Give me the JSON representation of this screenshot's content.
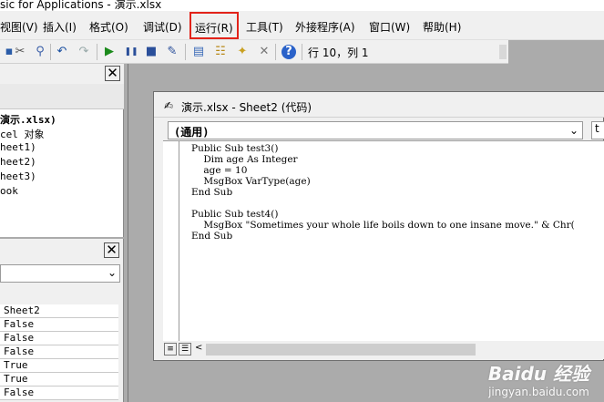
{
  "window": {
    "title": "sic for Applications - 演示.xlsx"
  },
  "menu": {
    "items": [
      {
        "label": "视图(V)"
      },
      {
        "label": "插入(I)"
      },
      {
        "label": "格式(O)"
      },
      {
        "label": "调试(D)"
      },
      {
        "label": "运行(R)"
      },
      {
        "label": "工具(T)"
      },
      {
        "label": "外接程序(A)"
      },
      {
        "label": "窗口(W)"
      },
      {
        "label": "帮助(H)"
      }
    ]
  },
  "toolbar": {
    "position_text": "行 10，列 1",
    "icons": [
      "save-icon",
      "cut-icon",
      "copy-icon",
      "paste-icon",
      "find-icon",
      "undo-icon",
      "redo-icon",
      "run-icon",
      "break-icon",
      "reset-icon",
      "design-mode-icon",
      "project-explorer-icon",
      "properties-icon",
      "object-browser-icon",
      "toolbox-icon",
      "help-icon"
    ]
  },
  "project_explorer": {
    "close_label": "✕",
    "tree": [
      "演示.xlsx)",
      "cel 对象",
      "heet1)",
      "heet2)",
      "heet3)",
      "ook"
    ]
  },
  "properties": {
    "close_label": "✕",
    "values": [
      "Sheet2",
      "False",
      "False",
      "False",
      "True",
      "True",
      "False"
    ]
  },
  "code_window": {
    "title": "演示.xlsx - Sheet2 (代码)",
    "object_select": "(通用)",
    "proc_select": "t",
    "code": "Public Sub test3()\n    Dim age As Integer\n    age = 10\n    MsgBox VarType(age)\nEnd Sub\n\nPublic Sub test4()\n    MsgBox \"Sometimes your whole life boils down to one insane move.\" & Chr(\nEnd Sub"
  },
  "watermark": {
    "brand": "Baidu 经验",
    "url": "jingyan.baidu.com"
  }
}
